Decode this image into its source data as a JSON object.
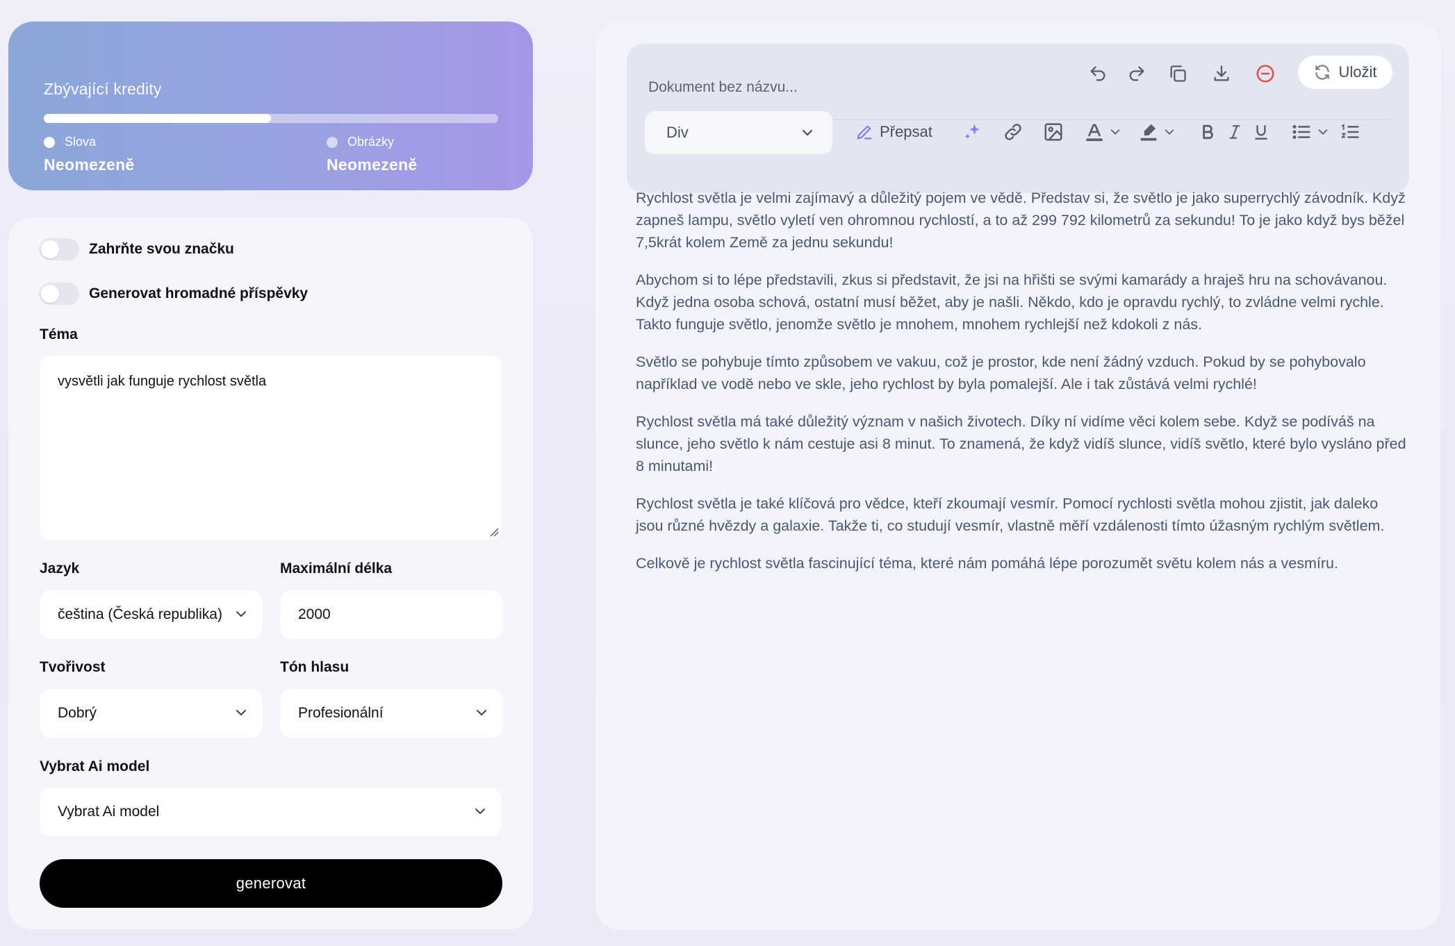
{
  "credits": {
    "title": "Zbývající kredity",
    "progress_fraction": 0.5,
    "words_label": "Slova",
    "words_value": "Neomezeně",
    "images_label": "Obrázky",
    "images_value": "Neomezeně"
  },
  "form": {
    "brand_toggle_label": "Zahrňte svou značku",
    "brand_toggle_on": false,
    "bulk_toggle_label": "Generovat hromadné příspěvky",
    "bulk_toggle_on": false,
    "topic_label": "Téma",
    "topic_value": "vysvětli jak funguje rychlost světla",
    "language_label": "Jazyk",
    "language_value": "čeština (Česká republika)",
    "max_length_label": "Maximální délka",
    "max_length_value": "2000",
    "creativity_label": "Tvořivost",
    "creativity_value": "Dobrý",
    "tone_label": "Tón hlasu",
    "tone_value": "Profesionální",
    "model_label": "Vybrat Ai model",
    "model_value": "Vybrat Ai model",
    "generate_label": "generovat"
  },
  "editor": {
    "doc_title_placeholder": "Dokument bez názvu...",
    "save_label": "Uložit",
    "block_type": "Div",
    "rewrite_label": "Přepsat",
    "icons": [
      "undo-icon",
      "redo-icon",
      "copy-icon",
      "download-icon",
      "delete-icon",
      "refresh-icon",
      "pencil-icon",
      "sparkle-icon",
      "link-icon",
      "image-icon",
      "text-color-icon",
      "highlight-icon",
      "bold-icon",
      "italic-icon",
      "underline-icon",
      "bullet-list-icon",
      "numbered-list-icon"
    ],
    "paragraphs": [
      "Rychlost světla je velmi zajímavý a důležitý pojem ve vědě. Představ si, že světlo je jako superrychlý závodník. Když zapneš lampu, světlo vyletí ven ohromnou rychlostí, a to až 299 792 kilometrů za sekundu! To je jako když bys běžel 7,5krát kolem Země za jednu sekundu!",
      "Abychom si to lépe představili, zkus si představit, že jsi na hřišti se svými kamarády a hraješ hru na schovávanou. Když jedna osoba schová, ostatní musí běžet, aby je našli. Někdo, kdo je opravdu rychlý, to zvládne velmi rychle. Takto funguje světlo, jenomže světlo je mnohem, mnohem rychlejší než kdokoli z nás.",
      "Světlo se pohybuje tímto způsobem ve vakuu, což je prostor, kde není žádný vzduch. Pokud by se pohybovalo například ve vodě nebo ve skle, jeho rychlost by byla pomalejší. Ale i tak zůstává velmi rychlé!",
      "Rychlost světla má také důležitý význam v našich životech. Díky ní vidíme věci kolem sebe. Když se podíváš na slunce, jeho světlo k nám cestuje asi 8 minut. To znamená, že když vidíš slunce, vidíš světlo, které bylo vysláno před 8 minutami!",
      "Rychlost světla je také klíčová pro vědce, kteří zkoumají vesmír. Pomocí rychlosti světla mohou zjistit, jak daleko jsou různé hvězdy a galaxie. Takže ti, co studují vesmír, vlastně měří vzdálenosti tímto úžasným rychlým světlem.",
      "Celkově je rychlost světla fascinující téma, které nám pomáhá lépe porozumět světu kolem nás a vesmíru."
    ]
  },
  "colors": {
    "accent_purple": "#a597e8",
    "accent_blue": "#8ba6d8",
    "delete_red": "#e5484d",
    "sparkle_purple": "#8b7cf0",
    "button_black": "#000000"
  }
}
